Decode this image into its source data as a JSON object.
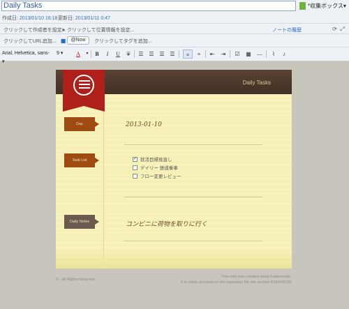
{
  "title": "Daily Tasks",
  "notebook": {
    "label": "*収集ボックス",
    "arrow": "▾"
  },
  "meta": {
    "created_label": "作成日:",
    "created_value": "2013/01/10 16:18",
    "updated_label": "更新日:",
    "updated_value": "2013/01/11 0:47"
  },
  "author_placeholder": "クリックして作成者を設定...",
  "location_placeholder": "クリックして位置情報を設定...",
  "history_link": "ノートの履歴",
  "url_placeholder": "クリックしてURL追加...",
  "now_button": "@Now",
  "tag_placeholder": "クリックしてタグを追加...",
  "toolbar": {
    "font": "Arial, Helvetica, sans-",
    "size": "9"
  },
  "note": {
    "header_title": "Daily Tasks",
    "day_label": "Day",
    "date_value": "2013-01-10",
    "task_label": "Task List",
    "tasks": [
      {
        "text": "就活目標見直し",
        "checked": true
      },
      {
        "text": "デイリー 鉄道乗車",
        "checked": false
      },
      {
        "text": "フロー変更レビュー",
        "checked": false
      }
    ],
    "notes_label": "Daily Notes",
    "notes_value": "コンビニに荷物を取りに行く"
  },
  "footer": {
    "copyright": "© . All Rights Reserved",
    "line1": "This note was created using Kustomnote.",
    "line2": "It is safely archived on the legendary file site archive EVERNOTE"
  }
}
